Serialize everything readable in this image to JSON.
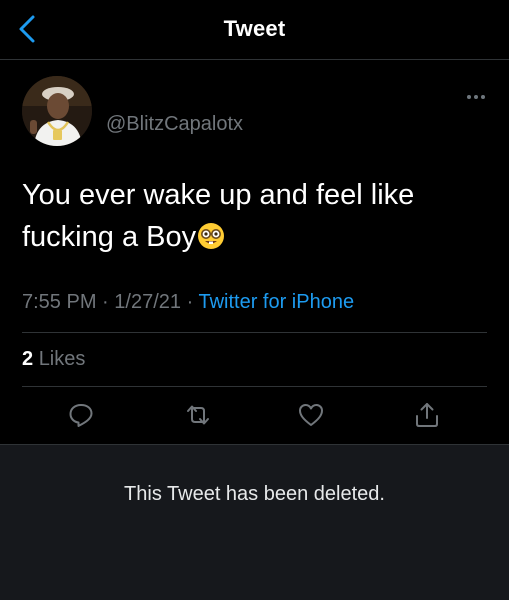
{
  "header": {
    "title": "Tweet",
    "back_icon": "chevron-left-icon",
    "accent_color": "#1d9bf0"
  },
  "tweet": {
    "handle": "@BlitzCapalotx",
    "text_line1": "You ever wake up and feel like",
    "text_line2": "fucking a Boy",
    "emoji": "nerd-face-emoji",
    "time": "7:55 PM",
    "date": "1/27/21",
    "separator": "·",
    "source": "Twitter for iPhone",
    "likes_count": "2",
    "likes_label": "Likes"
  },
  "actions": {
    "reply_icon": "reply-icon",
    "retweet_icon": "retweet-icon",
    "like_icon": "heart-icon",
    "share_icon": "share-icon"
  },
  "notice": {
    "deleted_text": "This Tweet has been deleted."
  }
}
